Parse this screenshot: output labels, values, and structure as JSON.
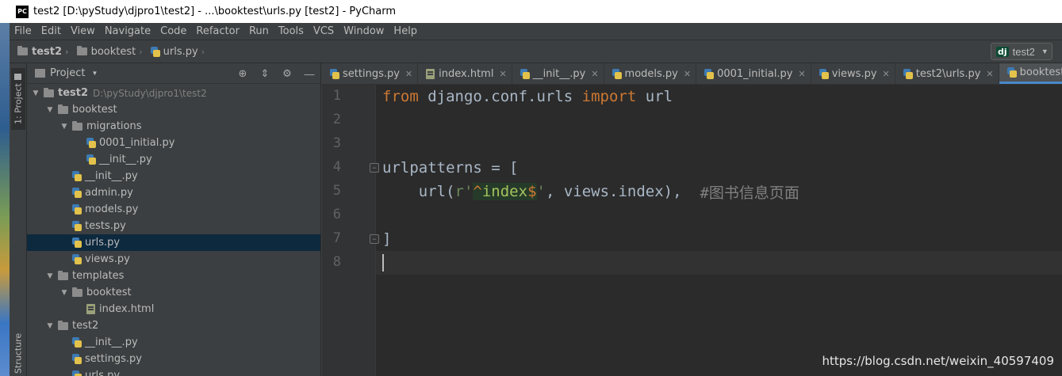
{
  "window": {
    "title": "test2 [D:\\pyStudy\\djpro1\\test2] - ...\\booktest\\urls.py [test2] - PyCharm",
    "logo_text": "PC"
  },
  "menu": [
    "File",
    "Edit",
    "View",
    "Navigate",
    "Code",
    "Refactor",
    "Run",
    "Tools",
    "VCS",
    "Window",
    "Help"
  ],
  "breadcrumb": [
    "test2",
    "booktest",
    "urls.py"
  ],
  "run_config": {
    "badge": "dj",
    "label": "test2"
  },
  "tool_windows": {
    "project": "1: Project",
    "structure": "Structure"
  },
  "project_panel": {
    "title": "Project",
    "tree": [
      {
        "label": "test2",
        "hint": "D:\\pyStudy\\djpro1\\test2",
        "type": "folder",
        "bold": true
      },
      {
        "label": "booktest",
        "type": "folder"
      },
      {
        "label": "migrations",
        "type": "folder"
      },
      {
        "label": "0001_initial.py",
        "type": "py"
      },
      {
        "label": "__init__.py",
        "type": "py"
      },
      {
        "label": "__init__.py",
        "type": "py"
      },
      {
        "label": "admin.py",
        "type": "py"
      },
      {
        "label": "models.py",
        "type": "py"
      },
      {
        "label": "tests.py",
        "type": "py"
      },
      {
        "label": "urls.py",
        "type": "py",
        "selected": true
      },
      {
        "label": "views.py",
        "type": "py"
      },
      {
        "label": "templates",
        "type": "folder"
      },
      {
        "label": "booktest",
        "type": "folder"
      },
      {
        "label": "index.html",
        "type": "html"
      },
      {
        "label": "test2",
        "type": "folder"
      },
      {
        "label": "__init__.py",
        "type": "py"
      },
      {
        "label": "settings.py",
        "type": "py"
      },
      {
        "label": "urls.py",
        "type": "py"
      }
    ]
  },
  "tabs": [
    {
      "label": "settings.py",
      "icon": "py"
    },
    {
      "label": "index.html",
      "icon": "html"
    },
    {
      "label": "__init__.py",
      "icon": "py"
    },
    {
      "label": "models.py",
      "icon": "py"
    },
    {
      "label": "0001_initial.py",
      "icon": "py"
    },
    {
      "label": "views.py",
      "icon": "py"
    },
    {
      "label": "test2\\urls.py",
      "icon": "py"
    },
    {
      "label": "booktest\\urls.py",
      "icon": "py",
      "active": true
    }
  ],
  "editor": {
    "line_numbers": [
      "1",
      "2",
      "3",
      "4",
      "5",
      "6",
      "7",
      "8"
    ],
    "code": {
      "l1_from": "from",
      "l1_mod": " django.conf.urls ",
      "l1_import": "import",
      "l1_name": " url",
      "l4": "urlpatterns = [",
      "l5_indent": "    url(",
      "l5_r": "r'",
      "l5_caret": "^",
      "l5_word": "index",
      "l5_dollar": "$",
      "l5_quote": "'",
      "l5_rest": ", views.index),  ",
      "l5_comment": "#图书信息页面",
      "l7": "]"
    }
  },
  "watermark": "https://blog.csdn.net/weixin_40597409",
  "colors": {
    "keyword": "#cc7832",
    "string": "#6a8759",
    "comment": "#808080",
    "accent": "#4a88c7",
    "selection": "#0d293e"
  }
}
